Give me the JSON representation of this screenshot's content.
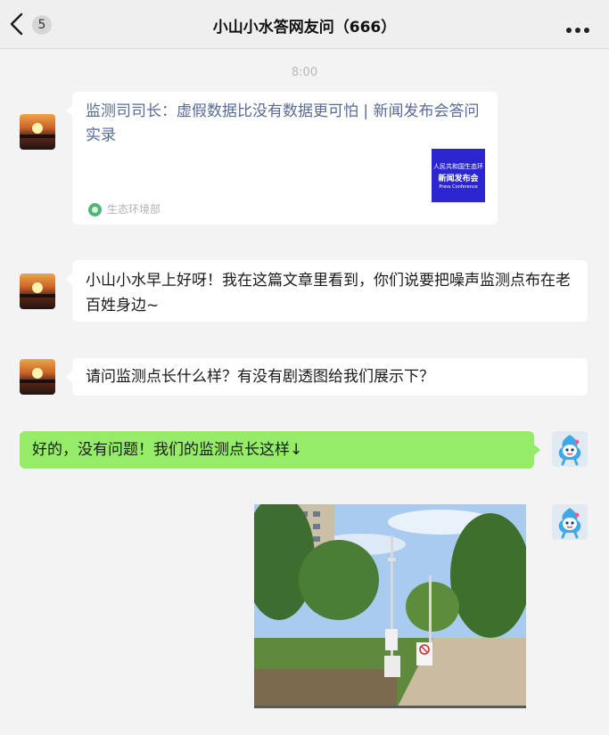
{
  "header": {
    "back_badge": "5",
    "title": "小山小水答网友问（666）"
  },
  "timestamp": "8:00",
  "messages": {
    "m1": {
      "card_title": "监测司司长：虚假数据比没有数据更可怕 | 新闻发布会答问实录",
      "thumb_line1": "人民共和国生态环",
      "thumb_line2": "新闻发布会",
      "thumb_line3": "Press Conference",
      "source": "生态环境部"
    },
    "m2": {
      "text": "小山小水早上好呀！我在这篇文章里看到，你们说要把噪声监测点布在老百姓身边~"
    },
    "m3": {
      "text": "请问监测点长什么样？有没有剧透图给我们展示下？"
    },
    "m4": {
      "text": "好的，没有问题！我们的监测点长这样↓"
    }
  },
  "icons": {
    "back": "chevron-left-icon",
    "more": "more-dots-icon",
    "source": "ministry-logo-icon",
    "noise_sign": "no-smoking-sign-icon"
  },
  "colors": {
    "link": "#576b95",
    "own_bubble": "#95ec69",
    "background": "#f3f3f3"
  }
}
